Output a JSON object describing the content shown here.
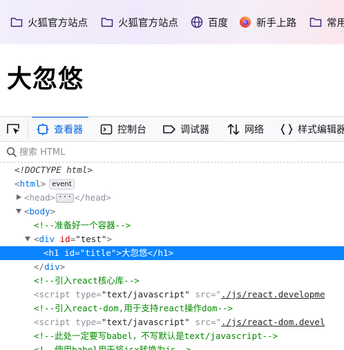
{
  "bookmarks": [
    {
      "label": "火狐官方站点",
      "icon": "folder-icon"
    },
    {
      "label": "火狐官方站点",
      "icon": "folder-icon"
    },
    {
      "label": "百度",
      "icon": "globe-icon"
    },
    {
      "label": "新手上路",
      "icon": "firefox-icon"
    },
    {
      "label": "常用",
      "icon": "folder-icon"
    }
  ],
  "page": {
    "heading": "大忽悠"
  },
  "devtools": {
    "tabs": [
      {
        "label": "查看器",
        "icon": "inspector-icon",
        "selected": true
      },
      {
        "label": "控制台",
        "icon": "console-icon"
      },
      {
        "label": "调试器",
        "icon": "debugger-icon"
      },
      {
        "label": "网络",
        "icon": "network-icon"
      },
      {
        "label": "样式编辑器",
        "icon": "style-editor-icon"
      }
    ],
    "search_placeholder": "搜索 HTML",
    "tree": {
      "doctype": "<!DOCTYPE html>",
      "html_tag": "html",
      "html_badge": "event",
      "head_tag": "head",
      "body_tag": "body",
      "comment1": "<!--准备好一个容器-->",
      "div_tag": "div",
      "div_attr": "id",
      "div_val": "\"test\"",
      "h1_tag": "h1",
      "h1_attr": "id",
      "h1_val": "\"title\"",
      "h1_text": "大忽悠",
      "comment2": "<!--引入react核心库-->",
      "script_tag": "script",
      "type_attr": "type",
      "type_val": "\"text/javascript\"",
      "src_attr": "src",
      "script1_src": "./js/react.developme",
      "comment3": "<!--引入react-dom,用于支持react操作dom-->",
      "script2_src": "./js/react-dom.devel",
      "comment4": "<!--此处一定要写babel，不写默认是text/javascript-->",
      "comment5": "<!--使用babel用于将jsx转换为js-->"
    }
  }
}
